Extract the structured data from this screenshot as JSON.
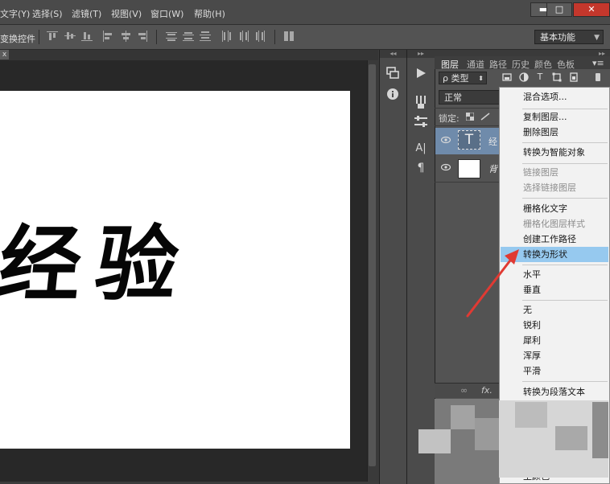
{
  "menubar": {
    "items": [
      "文字(Y)",
      "选择(S)",
      "滤镜(T)",
      "视图(V)",
      "窗口(W)",
      "帮助(H)"
    ],
    "minimize": "▬",
    "restore": "□",
    "close": "✕"
  },
  "options_bar": {
    "label": "变换控件",
    "workspace": "基本功能"
  },
  "document": {
    "close": "x",
    "canvas_text": "经验"
  },
  "dock_icons": {
    "history": "history-icon",
    "info": "info-icon",
    "play": "play-icon",
    "brush": "brush-icon",
    "adjust": "adjust-icon",
    "character": "A|",
    "paragraph": "¶"
  },
  "layers_panel": {
    "tabs": [
      "图层",
      "通道",
      "路径",
      "历史",
      "颜色",
      "色板"
    ],
    "kind_filter": "ρ 类型",
    "filter_text_glyph": "T",
    "blend_mode": "正常",
    "lock_label": "锁定:",
    "layers": [
      {
        "name": "经",
        "thumb": "T"
      },
      {
        "name": "背"
      }
    ],
    "footer_link": "∞",
    "footer_fx": "fx."
  },
  "context_menu": {
    "items": [
      {
        "label": "混合选项...",
        "disabled": false
      },
      {
        "sep": true
      },
      {
        "label": "复制图层...",
        "disabled": false
      },
      {
        "label": "删除图层",
        "disabled": false
      },
      {
        "sep": true
      },
      {
        "label": "转换为智能对象",
        "disabled": false
      },
      {
        "sep": true
      },
      {
        "label": "链接图层",
        "disabled": true
      },
      {
        "label": "选择链接图层",
        "disabled": true
      },
      {
        "sep": true
      },
      {
        "label": "栅格化文字",
        "disabled": false
      },
      {
        "label": "栅格化图层样式",
        "disabled": true
      },
      {
        "label": "创建工作路径",
        "disabled": false
      },
      {
        "label": "转换为形状",
        "disabled": false,
        "highlighted": true
      },
      {
        "sep": true
      },
      {
        "label": "水平",
        "disabled": false
      },
      {
        "label": "垂直",
        "disabled": false
      },
      {
        "sep": true
      },
      {
        "label": "无",
        "disabled": false
      },
      {
        "label": "锐利",
        "disabled": false
      },
      {
        "label": "犀利",
        "disabled": false
      },
      {
        "label": "浑厚",
        "disabled": false
      },
      {
        "label": "平滑",
        "disabled": false
      },
      {
        "sep": true
      },
      {
        "label": "转换为段落文本",
        "disabled": false
      },
      {
        "sep": true
      },
      {
        "label": "王颜色",
        "disabled": false
      }
    ]
  },
  "colors": {
    "highlight": "#96c9ef",
    "arrow": "#e03a33"
  }
}
